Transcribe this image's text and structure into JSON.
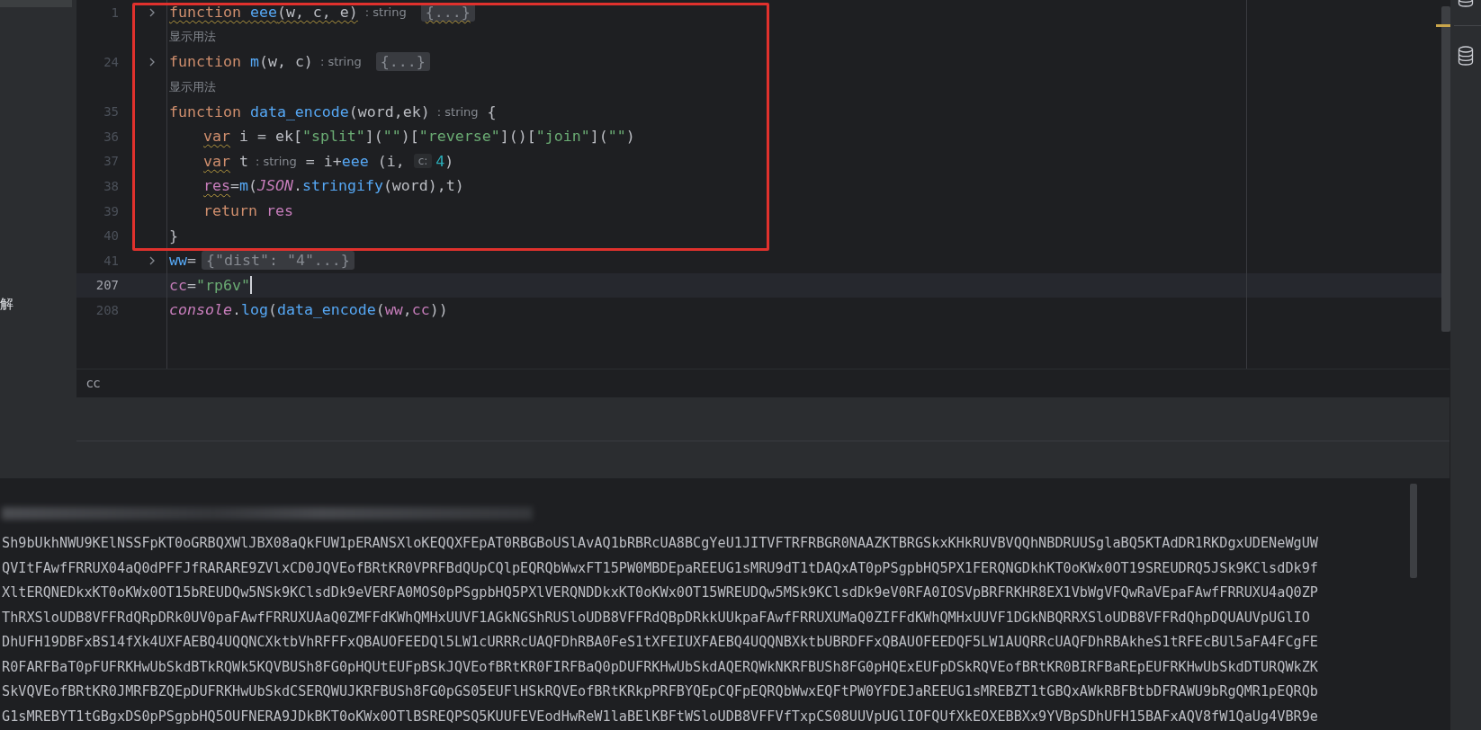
{
  "sidebar": {
    "text": "解"
  },
  "editor": {
    "lines": [
      {
        "kind": "code",
        "number": "1",
        "folded": true,
        "current": false,
        "indented": false,
        "tokens": [
          {
            "kind": "keyword",
            "t": "function ",
            "squiggle": true
          },
          {
            "kind": "fn",
            "t": "eee",
            "squiggle": true
          },
          {
            "kind": "plain",
            "t": "(w, c, e)",
            "squiggle": true
          },
          {
            "kind": "inlay",
            "t": ": string"
          },
          {
            "kind": "fold",
            "t": "{...}",
            "squiggle": true
          }
        ]
      },
      {
        "kind": "hint",
        "text": "显示用法"
      },
      {
        "kind": "code",
        "number": "24",
        "folded": true,
        "current": false,
        "indented": false,
        "tokens": [
          {
            "kind": "keyword",
            "t": "function "
          },
          {
            "kind": "fn",
            "t": "m"
          },
          {
            "kind": "plain",
            "t": "(w, c)"
          },
          {
            "kind": "inlay",
            "t": ": string"
          },
          {
            "kind": "fold",
            "t": "{...}"
          }
        ]
      },
      {
        "kind": "hint",
        "text": "显示用法"
      },
      {
        "kind": "code",
        "number": "35",
        "folded": false,
        "current": false,
        "indented": false,
        "tokens": [
          {
            "kind": "keyword",
            "t": "function "
          },
          {
            "kind": "fn",
            "t": "data_encode"
          },
          {
            "kind": "plain",
            "t": "(word,ek)"
          },
          {
            "kind": "inlay",
            "t": ": string"
          },
          {
            "kind": "plain",
            "t": "{"
          }
        ]
      },
      {
        "kind": "code",
        "number": "36",
        "folded": false,
        "current": false,
        "indented": true,
        "tokens": [
          {
            "kind": "keyword",
            "t": "var",
            "squiggle": true
          },
          {
            "kind": "plain",
            "t": " i = ek["
          },
          {
            "kind": "string",
            "t": "\"split\""
          },
          {
            "kind": "plain",
            "t": "]("
          },
          {
            "kind": "string",
            "t": "\"\""
          },
          {
            "kind": "plain",
            "t": ")["
          },
          {
            "kind": "string",
            "t": "\"reverse\""
          },
          {
            "kind": "plain",
            "t": "]()["
          },
          {
            "kind": "string",
            "t": "\"join\""
          },
          {
            "kind": "plain",
            "t": "]("
          },
          {
            "kind": "string",
            "t": "\"\""
          },
          {
            "kind": "plain",
            "t": ")"
          }
        ]
      },
      {
        "kind": "code",
        "number": "37",
        "folded": false,
        "current": false,
        "indented": true,
        "tokens": [
          {
            "kind": "keyword",
            "t": "var",
            "squiggle": true
          },
          {
            "kind": "plain",
            "t": " t"
          },
          {
            "kind": "inlay",
            "t": ": string"
          },
          {
            "kind": "plain",
            "t": "= i+"
          },
          {
            "kind": "fn",
            "t": "eee"
          },
          {
            "kind": "plain",
            "t": " (i, "
          },
          {
            "kind": "param",
            "t": "c:"
          },
          {
            "kind": "number",
            "t": "4"
          },
          {
            "kind": "plain",
            "t": ")"
          }
        ]
      },
      {
        "kind": "code",
        "number": "38",
        "folded": false,
        "current": false,
        "indented": true,
        "tokens": [
          {
            "kind": "variable",
            "t": "res",
            "squiggle": true
          },
          {
            "kind": "plain",
            "t": "="
          },
          {
            "kind": "fn",
            "t": "m"
          },
          {
            "kind": "plain",
            "t": "("
          },
          {
            "kind": "global",
            "t": "JSON"
          },
          {
            "kind": "plain",
            "t": "."
          },
          {
            "kind": "fn",
            "t": "stringify"
          },
          {
            "kind": "plain",
            "t": "(word),t)"
          }
        ]
      },
      {
        "kind": "code",
        "number": "39",
        "folded": false,
        "current": false,
        "indented": true,
        "tokens": [
          {
            "kind": "keyword",
            "t": "return "
          },
          {
            "kind": "variable",
            "t": "res"
          }
        ]
      },
      {
        "kind": "code",
        "number": "40",
        "folded": false,
        "current": false,
        "indented": false,
        "tokens": [
          {
            "kind": "plain",
            "t": "}"
          }
        ]
      },
      {
        "kind": "code",
        "number": "41",
        "folded": true,
        "current": false,
        "indented": false,
        "tokens": [
          {
            "kind": "fn",
            "t": "ww"
          },
          {
            "kind": "plain",
            "t": "="
          },
          {
            "kind": "fold",
            "t": "{\"dist\": \"4\"...}"
          }
        ]
      },
      {
        "kind": "code",
        "number": "207",
        "folded": false,
        "current": true,
        "indented": false,
        "tokens": [
          {
            "kind": "variable",
            "t": "cc"
          },
          {
            "kind": "plain",
            "t": "="
          },
          {
            "kind": "string",
            "t": "\"rp6v\""
          }
        ]
      },
      {
        "kind": "code",
        "number": "208",
        "folded": false,
        "current": false,
        "indented": false,
        "tokens": [
          {
            "kind": "global",
            "t": "console"
          },
          {
            "kind": "plain",
            "t": "."
          },
          {
            "kind": "fn",
            "t": "log"
          },
          {
            "kind": "plain",
            "t": "("
          },
          {
            "kind": "fn",
            "t": "data_encode"
          },
          {
            "kind": "plain",
            "t": "("
          },
          {
            "kind": "variable",
            "t": "ww"
          },
          {
            "kind": "plain",
            "t": ","
          },
          {
            "kind": "variable",
            "t": "cc"
          },
          {
            "kind": "plain",
            "t": "))"
          }
        ]
      }
    ]
  },
  "breadcrumb": "cc",
  "output": {
    "lines": [
      "Sh9bUkhNWU9KElNSSFpKT0oGRBQXWlJBX08aQkFUW1pERANSXloKEQQXFEpAT0RBGBoUSlAvAQ1bRBRcUA8BCgYeU1JITVFTRFRBGR0NAAZKTBRGSkxKHkRUVBVQQhNBDRUUSglaBQ5KTAdDR1RKDgxUDENeWgUW",
      "QVItFAwfFRRUX04aQ0dPFFJfRARARE9ZVlxCD0JQVEofBRtKR0VPRFBdQUpCQlpEQRQbWwxFT15PW0MBDEpaREEUG1sMRU9dT1tDAQxAT0pPSgpbHQ5PX1FERQNGDkhKT0oKWx0OT19SREUDRQ5JSk9KClsdDk9f",
      "XltERQNEDkxKT0oKWx0OT15bREUDQw5NSk9KClsdDk9eVERFA0MOS0pPSgpbHQ5PXlVERQNDDkxKT0oKWx0OT15WREUDQw5MSk9KClsdDk9eV0RFA0IOSVpBRFRKHR8EX1VbWgVFQwRaVEpaFAwfFRRUXU4aQ0ZP",
      "ThRXSloUDB8VFFRdQRpDRk0UV0paFAwfFRRUXUAaQ0ZMFFdKWhQMHxUUVF1AGkNGShRUSloUDB8VFFRdQBpDRkkUUkpaFAwfFRRUXUMaQ0ZIFFdKWhQMHxUUVF1DGkNBQRRXSloUDB8VFFRdQhpDQUAUVpUGlIO",
      "DhUFH19DBFxBS14fXk4UXFAEBQ4UQQNCXktbVhRFFFxQBAUOFEEDQl5LW1cURRRcUAQFDhRBA0FeS1tXFEIUXFAEBQ4UQQNBXktbUBRDFFxQBAUOFEEDQF5LW1AUQRRcUAQFDhRBAkheS1tRFEcBUl5aFA4FCgFE",
      "R0FARFBaT0pFUFRKHwUbSkdBTkRQWk5KQVBUSh8FG0pHQUtEUFpBSkJQVEofBRtKR0FIRFBaQ0pDUFRKHwUbSkdAQERQWkNKRFBUSh8FG0pHQExEUFpDSkRQVEofBRtKR0BIRFBaREpEUFRKHwUbSkdDTURQWkZK",
      "SkVQVEofBRtKR0JMRFBZQEpDUFRKHwUbSkdCSERQWUJKRFBUSh8FG0pGS05EUFlHSkRQVEofBRtKRkpPRFBYQEpCQFpEQRQbWwxEQFtPW0YFDEJaREEUG1sMREBZT1tGBQxAWkRBFBtbDFRAWU9bRgQMR1pEQRQb",
      "G1sMREBYT1tGBgxDS0pPSgpbHQ5OUFNERA9JDkBKT0oKWx0OTlBSREQPSQ5KUUFEVEodHwReW1laBElKBFtWSloUDB8VFFVfTxpCS08UUVpUGlIOFQUfXkEOXEBBXx9YVBpSDhUFH15BAFxAQV8fW1QaUg4VBR9e"
    ]
  }
}
